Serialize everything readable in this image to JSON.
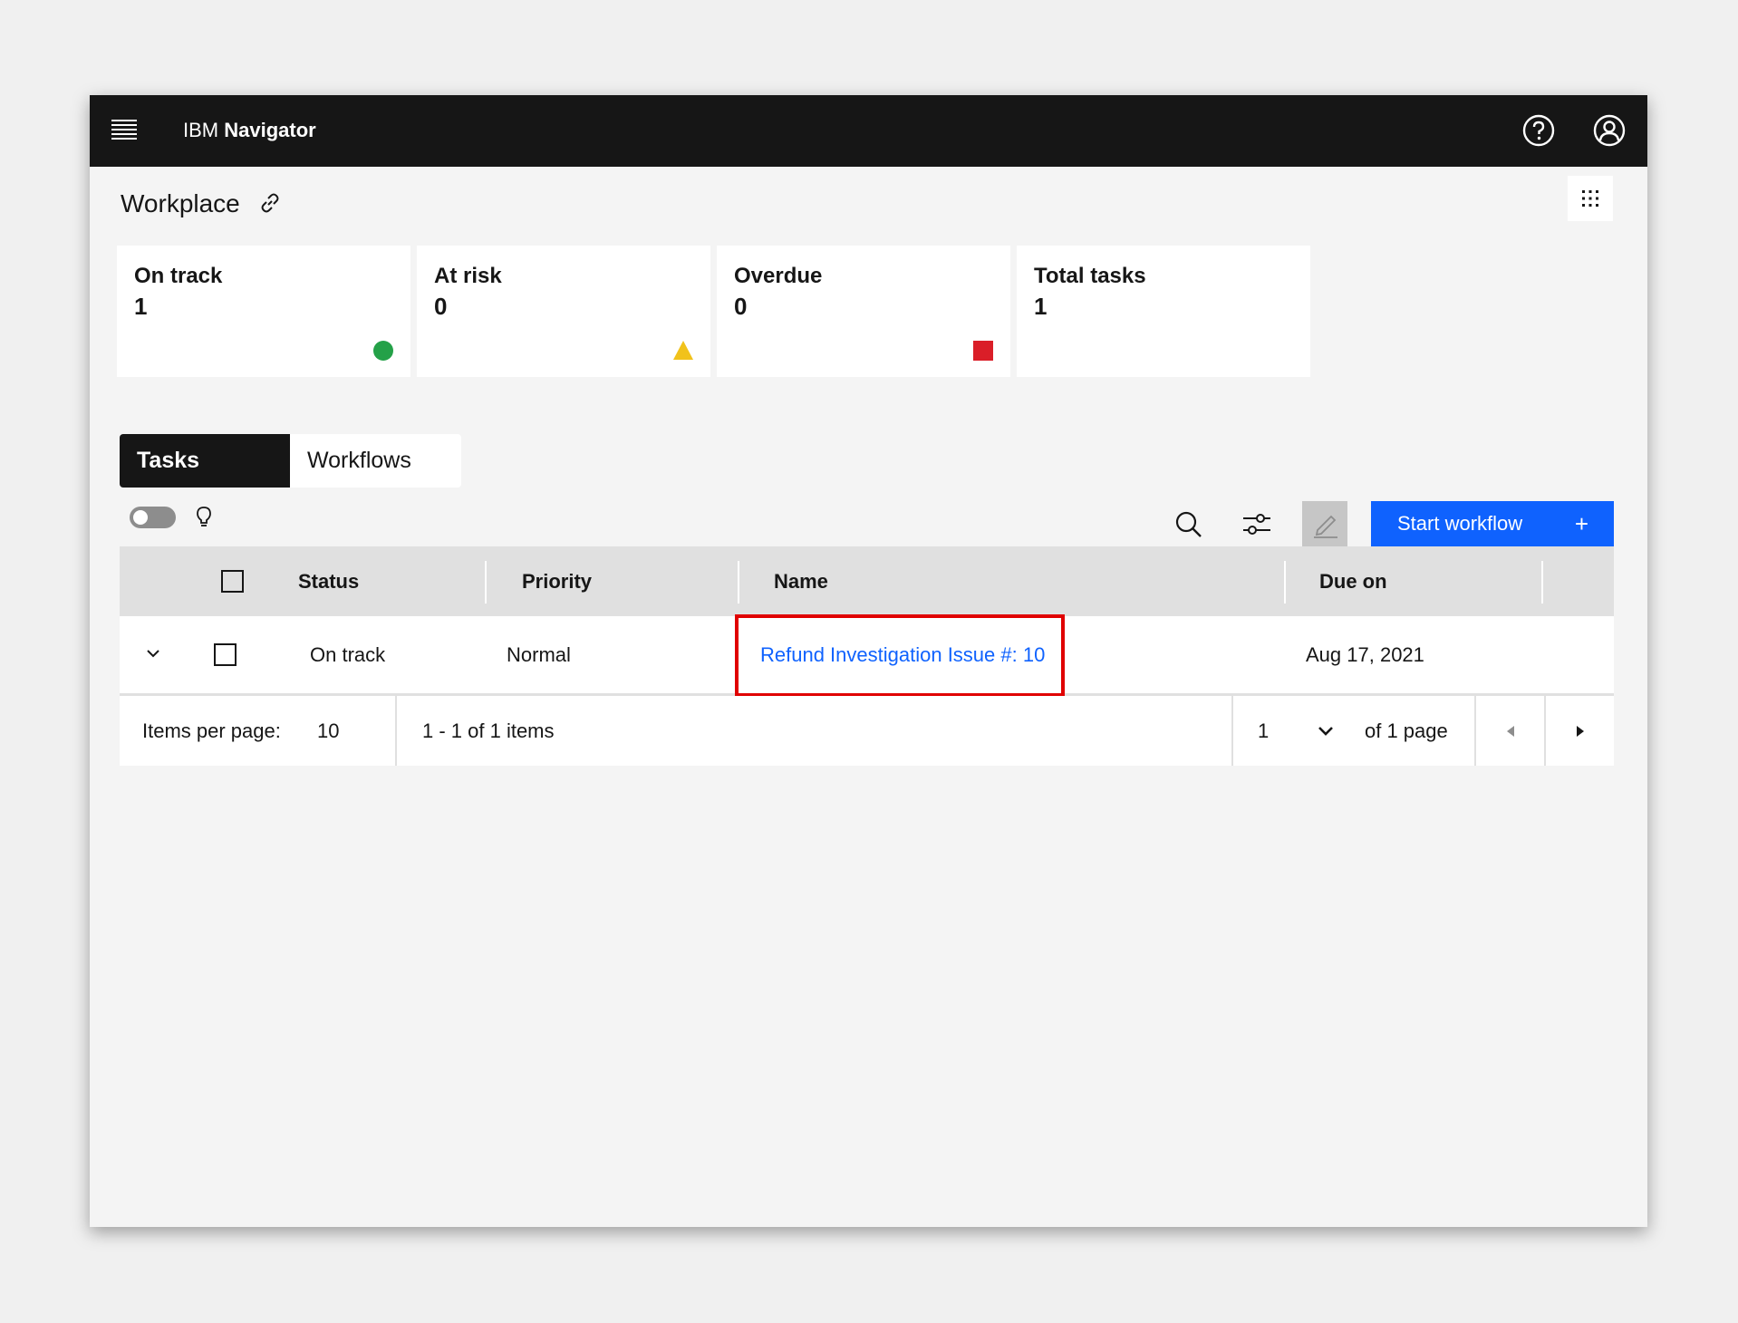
{
  "header": {
    "brand_prefix": "IBM",
    "brand_name": "Navigator"
  },
  "page": {
    "title": "Workplace"
  },
  "cards": [
    {
      "label": "On track",
      "value": "1",
      "indicator_color": "#24a148"
    },
    {
      "label": "At risk",
      "value": "0",
      "indicator_color": "#f1c21b"
    },
    {
      "label": "Overdue",
      "value": "0",
      "indicator_color": "#da1e28"
    },
    {
      "label": "Total tasks",
      "value": "1"
    }
  ],
  "tabs": [
    {
      "label": "Tasks"
    },
    {
      "label": "Workflows"
    }
  ],
  "toolbar": {
    "start_workflow_label": "Start workflow",
    "plus_label": "+"
  },
  "table": {
    "columns": [
      "Status",
      "Priority",
      "Name",
      "Due on"
    ],
    "rows": [
      {
        "status": "On track",
        "priority": "Normal",
        "name": "Refund Investigation Issue #: 10",
        "due_on": "Aug 17, 2021"
      }
    ]
  },
  "pagination": {
    "items_per_page_label": "Items per page:",
    "items_per_page": "10",
    "range_text": "1 - 1 of 1 items",
    "current_page": "1",
    "page_total_text": "of 1 page"
  },
  "colors": {
    "accent": "#0f62fe",
    "highlight": "#e00000",
    "topbar": "#161616"
  }
}
